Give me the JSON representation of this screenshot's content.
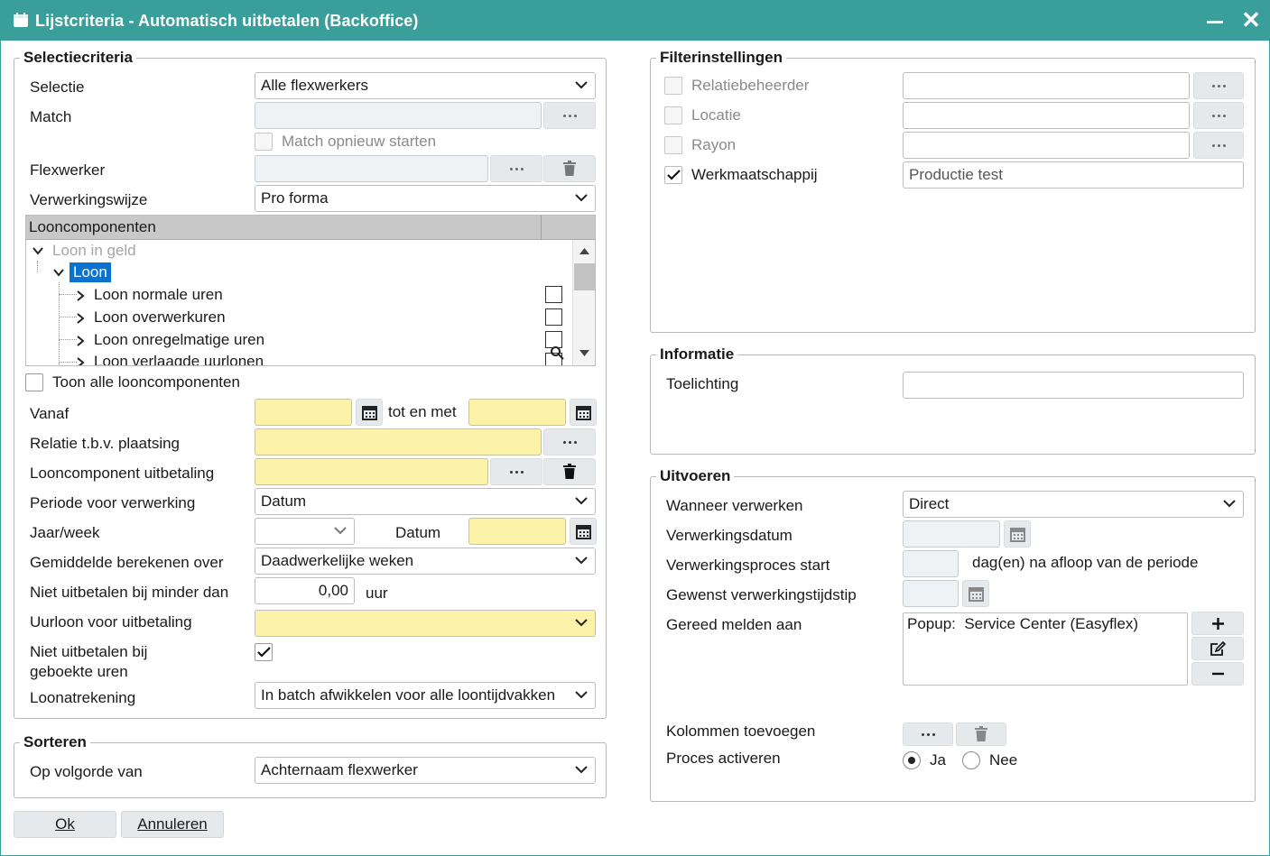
{
  "window": {
    "title": "Lijstcriteria - Automatisch uitbetalen (Backoffice)",
    "minimize_icon": "minimize-icon",
    "close_glyph": "✕"
  },
  "selectiecriteria": {
    "legend": "Selectiecriteria",
    "selectie": {
      "label": "Selectie",
      "value": "Alle flexwerkers"
    },
    "match": {
      "label": "Match",
      "value": ""
    },
    "match_opnieuw": {
      "label": "Match opnieuw starten",
      "checked": false
    },
    "flexwerker": {
      "label": "Flexwerker",
      "value": ""
    },
    "verwerkingswijze": {
      "label": "Verwerkingswijze",
      "value": "Pro forma"
    },
    "looncomponenten": {
      "header": "Looncomponenten",
      "items": [
        {
          "label": "Loon in geld"
        },
        {
          "label": "Loon"
        },
        {
          "label": "Loon normale uren"
        },
        {
          "label": "Loon overwerkuren"
        },
        {
          "label": "Loon onregelmatige uren"
        },
        {
          "label": "Loon verlaagde uurlonen"
        }
      ]
    },
    "toon_alle": {
      "label": "Toon alle looncomponenten",
      "checked": false
    },
    "vanaf": {
      "label": "Vanaf",
      "value": "",
      "tot_label": "tot en met",
      "tot_value": ""
    },
    "relatie": {
      "label": "Relatie t.b.v. plaatsing",
      "value": ""
    },
    "looncomponent_uitbetaling": {
      "label": "Looncomponent uitbetaling",
      "value": ""
    },
    "periode": {
      "label": "Periode voor verwerking",
      "value": "Datum"
    },
    "jaarweek": {
      "label": "Jaar/week",
      "value": "",
      "datum_label": "Datum",
      "datum_value": ""
    },
    "gemiddelde": {
      "label": "Gemiddelde berekenen over",
      "value": "Daadwerkelijke weken"
    },
    "niet_minder": {
      "label": "Niet uitbetalen bij minder dan",
      "value": "0,00",
      "unit": "uur"
    },
    "uurloon": {
      "label": "Uurloon voor uitbetaling",
      "value": ""
    },
    "niet_geboekt": {
      "label_line1": "Niet uitbetalen bij",
      "label_line2": "geboekte uren",
      "checked": true
    },
    "loonatrekening": {
      "label": "Loonatrekening",
      "value": "In batch afwikkelen voor alle loontijdvakken"
    }
  },
  "sorteren": {
    "legend": "Sorteren",
    "volgorde": {
      "label": "Op volgorde van",
      "value": "Achternaam flexwerker"
    }
  },
  "filterinstellingen": {
    "legend": "Filterinstellingen",
    "items": [
      {
        "label": "Relatiebeheerder",
        "checked": false,
        "value": ""
      },
      {
        "label": "Locatie",
        "checked": false,
        "value": ""
      },
      {
        "label": "Rayon",
        "checked": false,
        "value": ""
      },
      {
        "label": "Werkmaatschappij",
        "checked": true,
        "value": "Productie test"
      }
    ]
  },
  "informatie": {
    "legend": "Informatie",
    "toelichting": {
      "label": "Toelichting",
      "value": ""
    }
  },
  "uitvoeren": {
    "legend": "Uitvoeren",
    "wanneer": {
      "label": "Wanneer verwerken",
      "value": "Direct"
    },
    "verwerkingsdatum": {
      "label": "Verwerkingsdatum",
      "value": ""
    },
    "proces_start": {
      "label": "Verwerkingsproces start",
      "value": "",
      "suffix": "dag(en) na afloop van de periode"
    },
    "tijdstip": {
      "label": "Gewenst verwerkingstijdstip",
      "value": ""
    },
    "gereed": {
      "label": "Gereed melden aan",
      "value": "Popup:  Service Center (Easyflex)"
    },
    "kolommen": {
      "label": "Kolommen toevoegen"
    },
    "activeren": {
      "label": "Proces activeren",
      "ja": "Ja",
      "nee": "Nee",
      "selected": "Ja"
    }
  },
  "footer": {
    "ok": "Ok",
    "annuleren": "Annuleren"
  },
  "colors": {
    "titlebar": "#3a9e9a",
    "required": "#fdf3a8",
    "selected": "#0a72d0"
  }
}
